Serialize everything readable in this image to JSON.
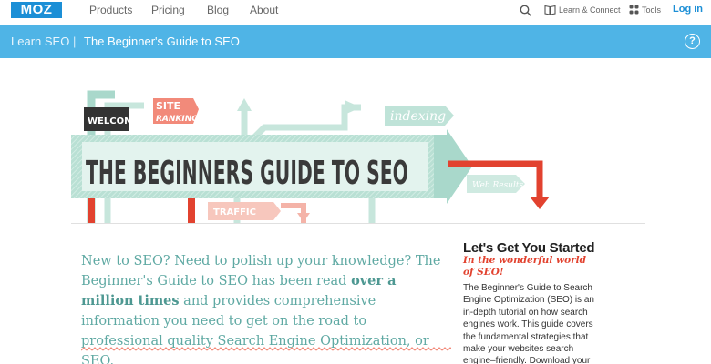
{
  "topnav": {
    "logo": "MOZ",
    "links": [
      "Products",
      "Pricing",
      "Blog",
      "About"
    ],
    "learn_connect": "Learn & Connect",
    "tools": "Tools",
    "login": "Log in"
  },
  "bluebar": {
    "root": "Learn SEO",
    "separator": "|",
    "title": "The Beginner's Guide to SEO",
    "help": "?"
  },
  "hero": {
    "welcome": "WELCOME",
    "site": "SITE",
    "ranking": "RANKING",
    "indexing": "indexing",
    "headline": "THE BEGINNERS GUIDE TO SEO",
    "web_results": "Web Results",
    "traffic": "TRAFFIC"
  },
  "intro": {
    "part1": "New to SEO? Need to polish up your knowledge? The Beginner's Guide to SEO has been read ",
    "bold": "over a million times",
    "part2": " and provides comprehensive information you need to get on the road to professional quality Search Engine Optimization, or SEO."
  },
  "sidebar": {
    "title": "Let's Get You Started",
    "subtitle": "In the wonderful world of SEO!",
    "body": "The Beginner's Guide to Search Engine Optimization (SEO) is an in-depth tutorial on how search engines work. This guide covers the fundamental strategies that make your websites search engine–friendly. Download your copy of the world's"
  },
  "colors": {
    "brand": "#1c8fd6",
    "bar": "#4fb4e6",
    "mint": "#a9d8cb",
    "red": "#e2422f",
    "salmon": "#f28a7a"
  }
}
